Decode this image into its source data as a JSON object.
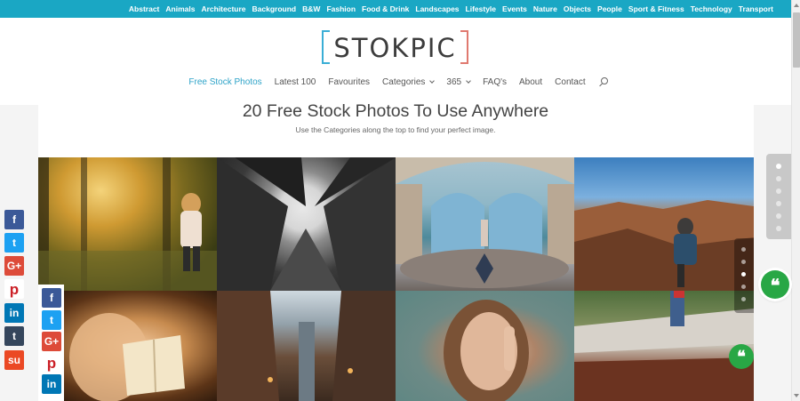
{
  "top_categories": [
    "Abstract",
    "Animals",
    "Architecture",
    "Background",
    "B&W",
    "Fashion",
    "Food & Drink",
    "Landscapes",
    "Lifestyle",
    "Events",
    "Nature",
    "Objects",
    "People",
    "Sport & Fitness",
    "Technology",
    "Transport"
  ],
  "logo": {
    "text": "STOKPIC"
  },
  "nav": {
    "items": [
      "Free Stock Photos",
      "Latest 100",
      "Favourites",
      "Categories",
      "365",
      "FAQ's",
      "About",
      "Contact"
    ],
    "active": "Free Stock Photos"
  },
  "page": {
    "title": "20 Free Stock Photos To Use Anywhere",
    "subtitle": "Use the Categories along the top to find your perfect image."
  },
  "share_icons": {
    "left_column": [
      "f",
      "t",
      "G+",
      "p",
      "in",
      "t",
      "su"
    ],
    "inner_column": [
      "f",
      "t",
      "G+",
      "p",
      "in"
    ]
  },
  "photos": [
    "forest-swing",
    "skyscrapers-bw",
    "ornate-hall",
    "canyon-hiker",
    "reading-book",
    "city-towers",
    "woman-rock-sign",
    "jumping-girl"
  ],
  "quote_glyph": "❝",
  "colors": {
    "brand": "#1aa7c4",
    "active_nav": "#2ea3c8",
    "quote_button": "#28a745"
  }
}
